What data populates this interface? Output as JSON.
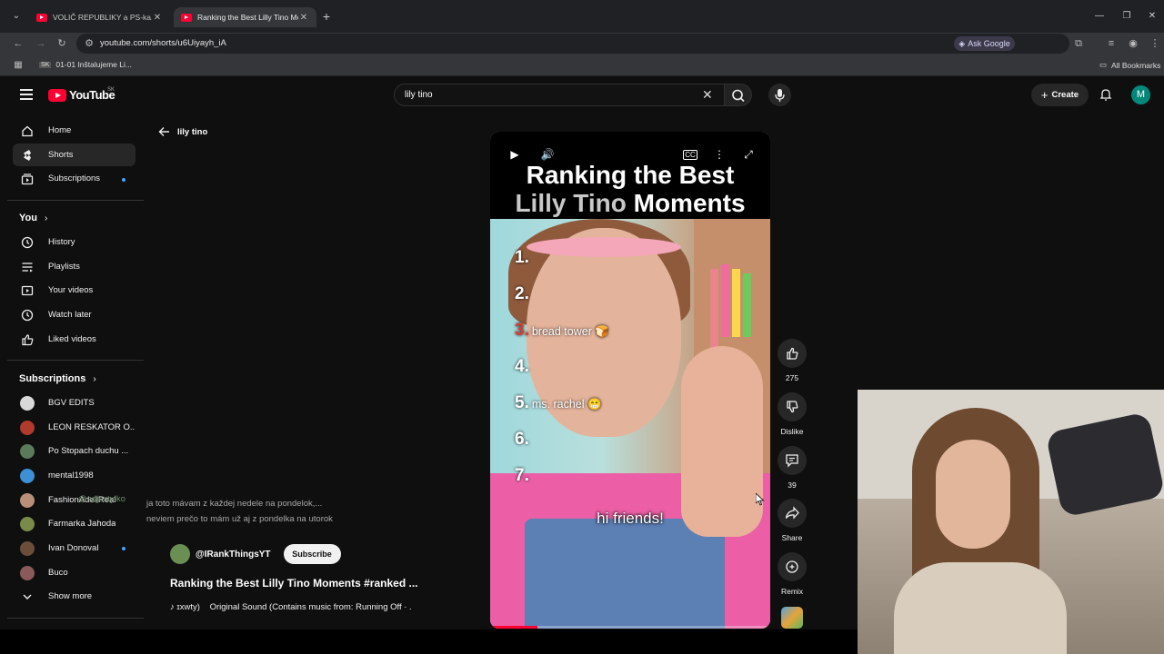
{
  "browser": {
    "tabs": [
      {
        "title": "VOLIČ REPUBLIKY a PS-ka. Dok"
      },
      {
        "title": "Ranking the Best Lilly Tino Mom"
      }
    ],
    "url": "youtube.com/shorts/u6Uiyayh_iA",
    "ask_google": "Ask Google",
    "bookmark_item": "01-01 Inštalujeme Li...",
    "all_bookmarks": "All Bookmarks"
  },
  "header": {
    "logo_text": "YouTube",
    "region": "SK",
    "search_value": "lily tino",
    "create_label": "Create",
    "avatar_letter": "M"
  },
  "sidebar": {
    "main": [
      {
        "label": "Home",
        "icon": "home-icon"
      },
      {
        "label": "Shorts",
        "icon": "shorts-icon"
      },
      {
        "label": "Subscriptions",
        "icon": "subscriptions-icon"
      }
    ],
    "you_heading": "You",
    "you_items": [
      {
        "label": "History",
        "icon": "history-icon"
      },
      {
        "label": "Playlists",
        "icon": "playlists-icon"
      },
      {
        "label": "Your videos",
        "icon": "your-videos-icon"
      },
      {
        "label": "Watch later",
        "icon": "watch-later-icon"
      },
      {
        "label": "Liked videos",
        "icon": "liked-videos-icon"
      }
    ],
    "subs_heading": "Subscriptions",
    "subscriptions": [
      {
        "label": "BGV EDITS",
        "color": "#d9d9d9"
      },
      {
        "label": "LEON RESKATOR O...",
        "color": "#b03a2e"
      },
      {
        "label": "Po Stopach duchu ...",
        "color": "#5a7a5a"
      },
      {
        "label": "mental1998",
        "color": "#3d8fd6"
      },
      {
        "label": "FashionAdellReal",
        "color": "#b98f7a"
      },
      {
        "label": "Farmarka Jahoda",
        "color": "#7a8a4a"
      },
      {
        "label": "Ivan Donoval",
        "color": "#6b4e3a"
      },
      {
        "label": "Buco",
        "color": "#8a5a5a"
      }
    ],
    "show_more": "Show more"
  },
  "back_link": "lily tino",
  "video": {
    "title_line1": "Ranking the Best",
    "title_line2a": "Lilly Tino",
    "title_line2b": "Moments",
    "ranks": [
      {
        "n": "1.",
        "label": ""
      },
      {
        "n": "2.",
        "label": ""
      },
      {
        "n": "3.",
        "label": "bread tower 🍞"
      },
      {
        "n": "4.",
        "label": ""
      },
      {
        "n": "5.",
        "label": "ms. rachel 😁"
      },
      {
        "n": "6.",
        "label": ""
      },
      {
        "n": "7.",
        "label": ""
      }
    ],
    "subtitle": "hi friends!",
    "progress": 0.17
  },
  "actions": {
    "likes": "275",
    "dislike": "Dislike",
    "comments": "39",
    "share": "Share",
    "remix": "Remix"
  },
  "overlay": {
    "user": "@adjestylko",
    "line1": "ja toto mávam z každej nedele na pondelok,...",
    "line2": "neviem prečo to mám už aj z pondelka na utorok"
  },
  "info": {
    "channel": "@IRankThingsYT",
    "subscribe": "Subscribe",
    "title": "Ranking the Best Lilly Tino Moments #ranked ...",
    "sound_prefix": "ɪxwty)",
    "sound": "Original Sound (Contains music from: Running Off · ."
  }
}
